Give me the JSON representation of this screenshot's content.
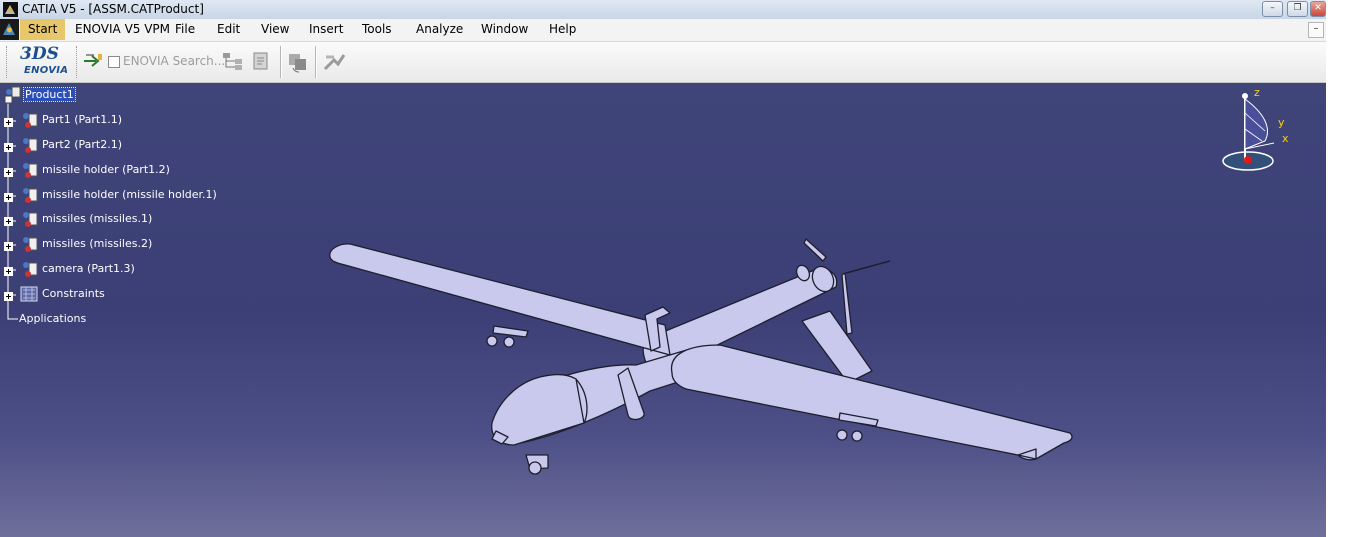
{
  "window": {
    "title": "CATIA V5 - [ASSM.CATProduct]",
    "controls": [
      "–",
      "❐",
      "✕"
    ]
  },
  "menubar": {
    "items": [
      "Start",
      "ENOVIA V5 VPM",
      "File",
      "Edit",
      "View",
      "Insert",
      "Tools",
      "Analyze",
      "Window",
      "Help"
    ],
    "mdi_close": "–"
  },
  "toolbar": {
    "logo_mark": "3DS",
    "logo_word": "ENOVIA",
    "search_label": "ENOVIA Search..."
  },
  "tree": {
    "root": "Product1",
    "children": [
      "Part1 (Part1.1)",
      "Part2 (Part2.1)",
      "missile holder (Part1.2)",
      "missile holder (missile holder.1)",
      "missiles (missiles.1)",
      "missiles (missiles.2)",
      "camera (Part1.3)",
      "Constraints",
      "Applications"
    ]
  },
  "compass": {
    "z": "z",
    "y": "y",
    "x": "x"
  },
  "colors": {
    "viewport": "#3f4479",
    "tree_selection": "#2a4fb8",
    "model_fill": "#c9c9ee",
    "model_edge": "#1e1e2e",
    "start_highlight": "#e8c76a"
  }
}
